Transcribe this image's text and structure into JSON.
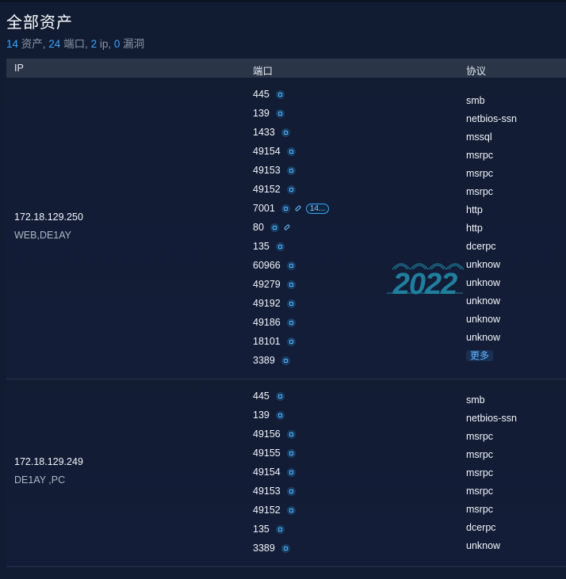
{
  "page": {
    "title": "全部资产",
    "summary": {
      "assets_count": "14",
      "assets_label": " 资产, ",
      "ports_count": "24",
      "ports_label": " 端口, ",
      "ip_count": "2",
      "ip_label": " ip, ",
      "vuln_count": "0",
      "vuln_label": " 漏洞"
    }
  },
  "table": {
    "columns": {
      "ip": "IP",
      "port": "端口",
      "protocol": "协议"
    },
    "rows": [
      {
        "ip": "172.18.129.250",
        "tag": "WEB,DE1AY",
        "ports": [
          {
            "port": "445"
          },
          {
            "port": "139"
          },
          {
            "port": "1433"
          },
          {
            "port": "49154"
          },
          {
            "port": "49153"
          },
          {
            "port": "49152"
          },
          {
            "port": "7001",
            "pill": "14..."
          },
          {
            "port": "80"
          },
          {
            "port": "135"
          },
          {
            "port": "60966"
          },
          {
            "port": "49279"
          },
          {
            "port": "49192"
          },
          {
            "port": "49186"
          },
          {
            "port": "18101"
          },
          {
            "port": "3389"
          }
        ],
        "protocols": [
          "smb",
          "netbios-ssn",
          "mssql",
          "msrpc",
          "msrpc",
          "msrpc",
          "http",
          "http",
          "dcerpc",
          "unknow",
          "unknow",
          "unknow",
          "unknow",
          "unknow"
        ],
        "more_label": "更多"
      },
      {
        "ip": "172.18.129.249",
        "tag": "DE1AY ,PC",
        "ports": [
          {
            "port": "445"
          },
          {
            "port": "139"
          },
          {
            "port": "49156"
          },
          {
            "port": "49155"
          },
          {
            "port": "49154"
          },
          {
            "port": "49153"
          },
          {
            "port": "49152"
          },
          {
            "port": "135"
          },
          {
            "port": "3389"
          }
        ],
        "protocols": [
          "smb",
          "netbios-ssn",
          "msrpc",
          "msrpc",
          "msrpc",
          "msrpc",
          "msrpc",
          "dcerpc",
          "unknow"
        ]
      }
    ]
  },
  "watermark": {
    "text": "2022",
    "color": "#1f7f9e"
  },
  "icons": {
    "detail": "detail-icon",
    "link": "link-icon"
  },
  "colors": {
    "accent": "#3aa6ff",
    "background": "#111c33",
    "header": "#2a3548"
  }
}
